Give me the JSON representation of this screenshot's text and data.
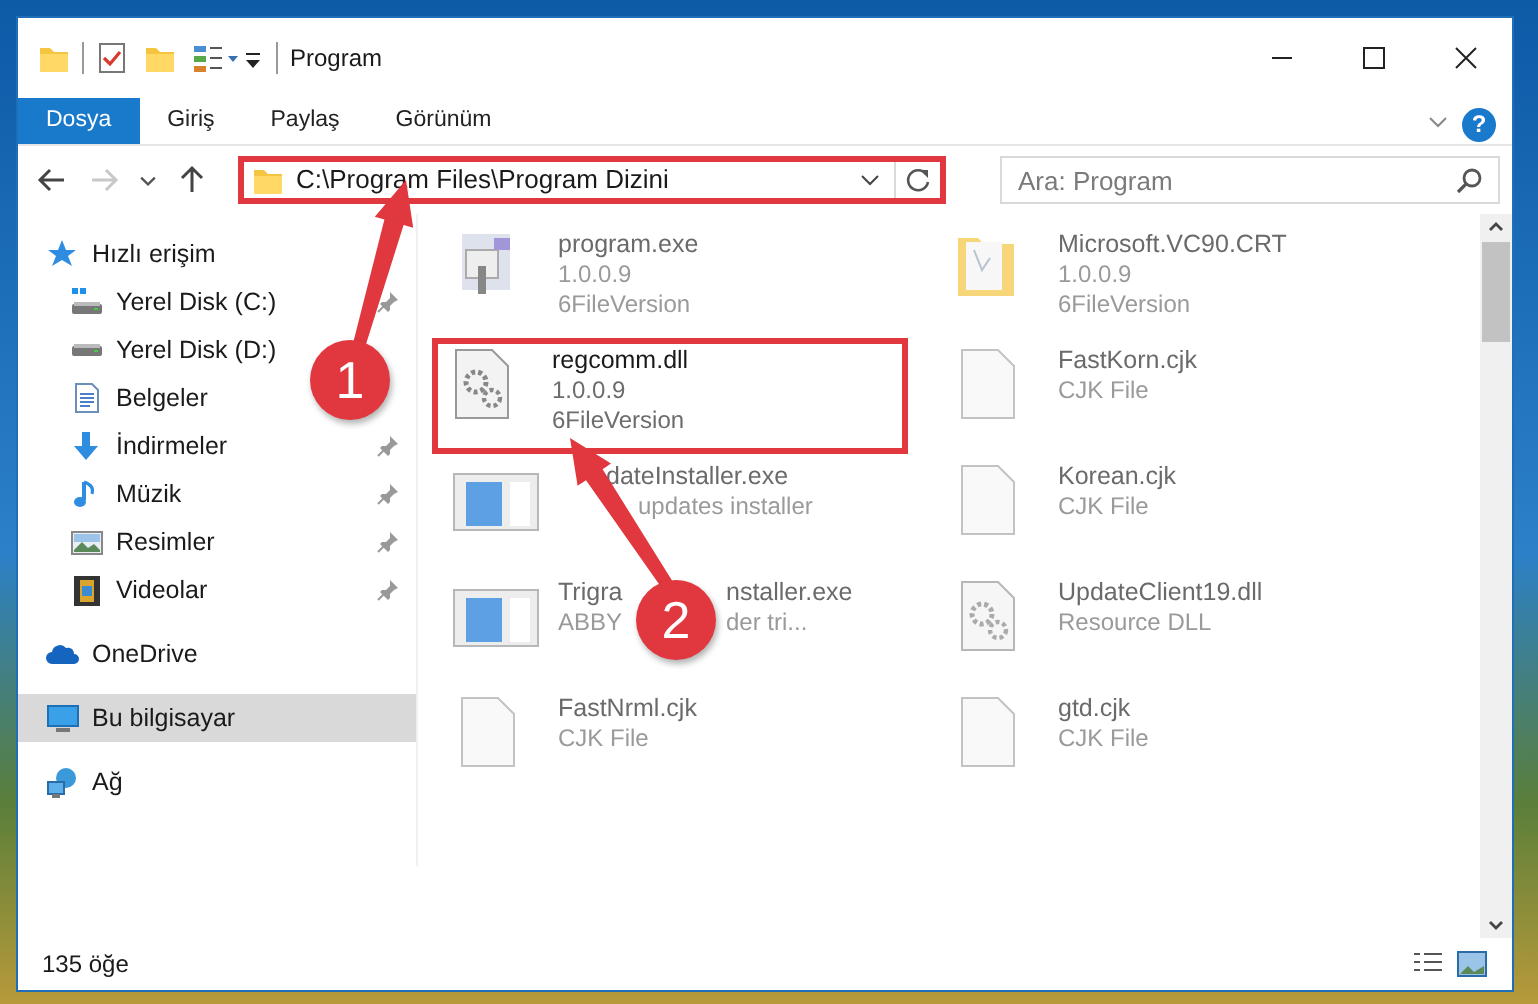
{
  "window": {
    "title": "Program"
  },
  "ribbon": {
    "tabs": [
      {
        "label": "Dosya",
        "selected": true
      },
      {
        "label": "Giriş",
        "selected": false
      },
      {
        "label": "Paylaş",
        "selected": false
      },
      {
        "label": "Görünüm",
        "selected": false
      }
    ],
    "help": "?"
  },
  "address_bar": {
    "path": "C:\\Program Files\\Program Dizini",
    "highlighted": true
  },
  "search": {
    "placeholder": "Ara: Program"
  },
  "nav": [
    {
      "label": "Hızlı erişim",
      "kind": "star",
      "selected": false,
      "children": [
        {
          "label": "Yerel Disk (C:)",
          "kind": "system-drive",
          "pinned": true,
          "selected": false
        },
        {
          "label": "Yerel Disk (D:)",
          "kind": "drive",
          "pinned": false,
          "selected": false
        },
        {
          "label": "Belgeler",
          "kind": "documents",
          "pinned": false,
          "selected": false
        },
        {
          "label": "İndirmeler",
          "kind": "downloads",
          "pinned": true,
          "selected": false
        },
        {
          "label": "Müzik",
          "kind": "music",
          "pinned": true,
          "selected": false
        },
        {
          "label": "Resimler",
          "kind": "pictures",
          "pinned": true,
          "selected": false
        },
        {
          "label": "Videolar",
          "kind": "videos",
          "pinned": true,
          "selected": false
        }
      ]
    },
    {
      "label": "OneDrive",
      "kind": "cloud",
      "selected": false
    },
    {
      "label": "Bu bilgisayar",
      "kind": "computer",
      "selected": true
    },
    {
      "label": "Ağ",
      "kind": "network",
      "selected": false
    }
  ],
  "files": [
    {
      "name": "program.exe",
      "details": [
        "1.0.0.9",
        "6FileVersion"
      ],
      "kind": "app",
      "highlighted": false,
      "blurred": true
    },
    {
      "name": "Microsoft.VC90.CRT",
      "details": [
        "1.0.0.9",
        "6FileVersion"
      ],
      "kind": "folder",
      "highlighted": false,
      "blurred": true
    },
    {
      "name": "regcomm.dll",
      "details": [
        "1.0.0.9",
        "6FileVersion"
      ],
      "kind": "gears",
      "highlighted": true,
      "blurred": false
    },
    {
      "name": "FastKorn.cjk",
      "details": [
        "CJK File"
      ],
      "kind": "blank",
      "highlighted": false,
      "blurred": true
    },
    {
      "name": [
        "dateInstaller.exe"
      ],
      "details": [
        [
          "updates installer"
        ]
      ],
      "kind": "window",
      "covered_start": true,
      "highlighted": false,
      "blurred": true
    },
    {
      "name": "Korean.cjk",
      "details": [
        "CJK File"
      ],
      "kind": "blank",
      "highlighted": false,
      "blurred": true
    },
    {
      "name": [
        "Trigra",
        "nstaller.exe"
      ],
      "details": [
        [
          "ABBY",
          "der tri..."
        ]
      ],
      "kind": "window",
      "highlighted": false,
      "blurred": true
    },
    {
      "name": "UpdateClient19.dll",
      "details": [
        "Resource DLL"
      ],
      "kind": "gears",
      "highlighted": false,
      "blurred": true
    },
    {
      "name": "FastNrml.cjk",
      "details": [
        "CJK File"
      ],
      "kind": "blank",
      "highlighted": false,
      "blurred": true
    },
    {
      "name": "gtd.cjk",
      "details": [
        "CJK File"
      ],
      "kind": "blank",
      "highlighted": false,
      "blurred": true
    }
  ],
  "status_bar": {
    "count": "135 öğe"
  },
  "annotations": [
    {
      "number": "1"
    },
    {
      "number": "2"
    }
  ]
}
